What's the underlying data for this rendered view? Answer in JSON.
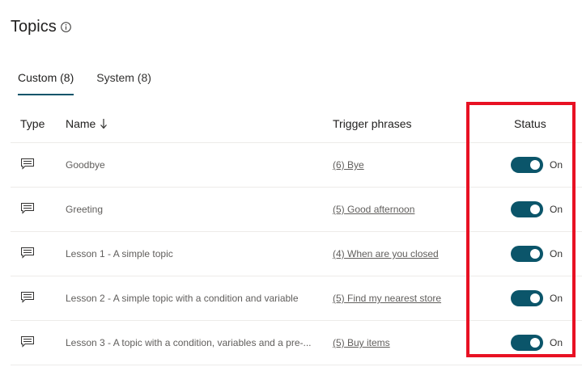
{
  "page": {
    "title": "Topics",
    "info_icon": "info-icon"
  },
  "tabs": [
    {
      "label": "Custom (8)",
      "active": true
    },
    {
      "label": "System (8)",
      "active": false
    }
  ],
  "table": {
    "headers": {
      "type": "Type",
      "name": "Name",
      "trigger": "Trigger phrases",
      "status": "Status"
    },
    "sort_icon": "arrow-down-icon",
    "rows": [
      {
        "type_icon": "chat-icon",
        "name": "Goodbye",
        "trigger": "(6) Bye",
        "status": "On"
      },
      {
        "type_icon": "chat-icon",
        "name": "Greeting",
        "trigger": "(5) Good afternoon",
        "status": "On"
      },
      {
        "type_icon": "chat-icon",
        "name": "Lesson 1 - A simple topic",
        "trigger": "(4) When are you closed",
        "status": "On"
      },
      {
        "type_icon": "chat-icon",
        "name": "Lesson 2 - A simple topic with a condition and variable",
        "trigger": "(5) Find my nearest store",
        "status": "On"
      },
      {
        "type_icon": "chat-icon",
        "name": "Lesson 3 - A topic with a condition, variables and a pre-...",
        "trigger": "(5) Buy items",
        "status": "On"
      }
    ]
  },
  "colors": {
    "accent": "#0b556a",
    "highlight": "#e81123"
  }
}
